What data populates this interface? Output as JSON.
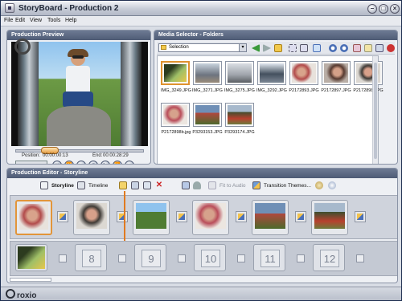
{
  "app": {
    "title": "StoryBoard - Production 2"
  },
  "menu": [
    "File",
    "Edit",
    "View",
    "Tools",
    "Help"
  ],
  "preview": {
    "header": "Production Preview",
    "position_label": "Position:",
    "position": "00:00:00:13",
    "end_label": "End:",
    "end": "00:00:28:29"
  },
  "media": {
    "header": "Media Selector - Folders",
    "select_value": "Selection",
    "files": [
      "IMG_3249.JPG",
      "IMG_3271.JPG",
      "IMG_3275.JPG",
      "IMG_3292.JPG",
      "P2172893.JPG",
      "P2172897.JPG",
      "P2172898.JPG",
      "P2172898b.jpg",
      "P3293153.JPG",
      "P3293174.JPG"
    ],
    "abc_label": "abc"
  },
  "editor": {
    "header": "Production Editor - Storyline",
    "storyline_label": "Storyline",
    "timeline_label": "Timeline",
    "fit_audio_label": "Fit to Audio",
    "transition_label": "Transition Themes...",
    "slots": [
      "8",
      "9",
      "10",
      "11",
      "12"
    ]
  },
  "brand": {
    "logo": "roxio"
  },
  "colors": {
    "accent": "#e2953a",
    "header": "#5a6782"
  }
}
